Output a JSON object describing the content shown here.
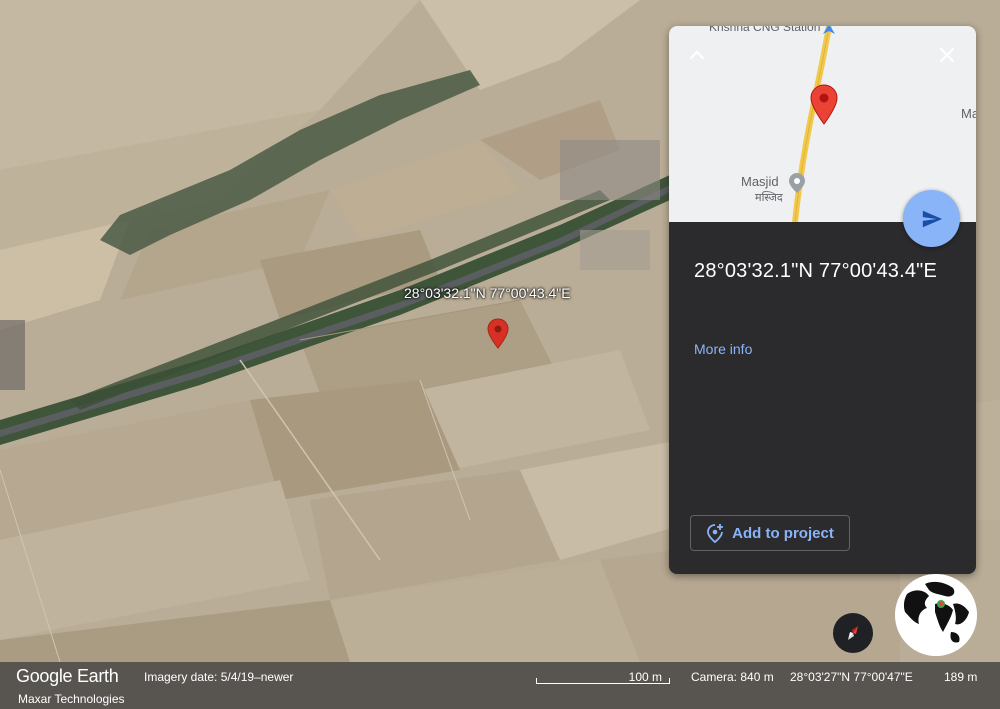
{
  "pin_label": "28°03'32.1\"N 77°00'43.4\"E",
  "panel": {
    "coordinates": "28°03'32.1\"N 77°00'43.4\"E",
    "more_info": "More info",
    "add_to_project": "Add to project",
    "mini_map": {
      "poi_top": "Krishna CNG Station",
      "poi_masjid": "Masjid",
      "poi_masjid_hindi": "मस्जिद",
      "poi_edge": "Ma"
    }
  },
  "footer": {
    "logo": "Google Earth",
    "attribution": "Maxar Technologies",
    "imagery_date": "Imagery date: 5/4/19–newer",
    "scale": "100 m",
    "camera": "Camera: 840 m",
    "coords": "28°03'27\"N 77°00'47\"E",
    "elevation": "189 m"
  },
  "colors": {
    "panel_bg": "#2b2b2d",
    "accent_blue": "#8ab4f8",
    "pin_red": "#d93025",
    "road_yellow": "#f2c94c"
  },
  "icons": [
    "chevron-up-icon",
    "close-icon",
    "send-icon",
    "add-location-icon",
    "compass-icon",
    "map-pin-icon"
  ]
}
